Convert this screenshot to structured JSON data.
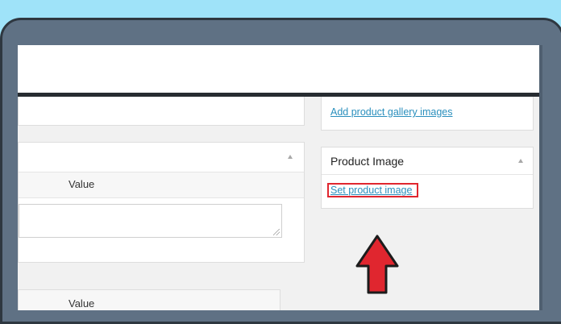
{
  "product_data": {
    "attributes": {
      "value_header": "Value",
      "bottom_value_header": "Value"
    }
  },
  "sidebar": {
    "gallery_link": "Add product gallery images",
    "product_image": {
      "title": "Product Image",
      "set_link": "Set product image"
    }
  },
  "icons": {
    "collapse": "caret-up-icon",
    "pointer": "red-arrow-icon",
    "resize": "resize-handle-icon"
  },
  "colors": {
    "sky": "#9fe3f9",
    "laptop": "#5f7184",
    "link": "#2a8fbd",
    "highlight": "#e0262f",
    "arrow": "#e0262f"
  }
}
